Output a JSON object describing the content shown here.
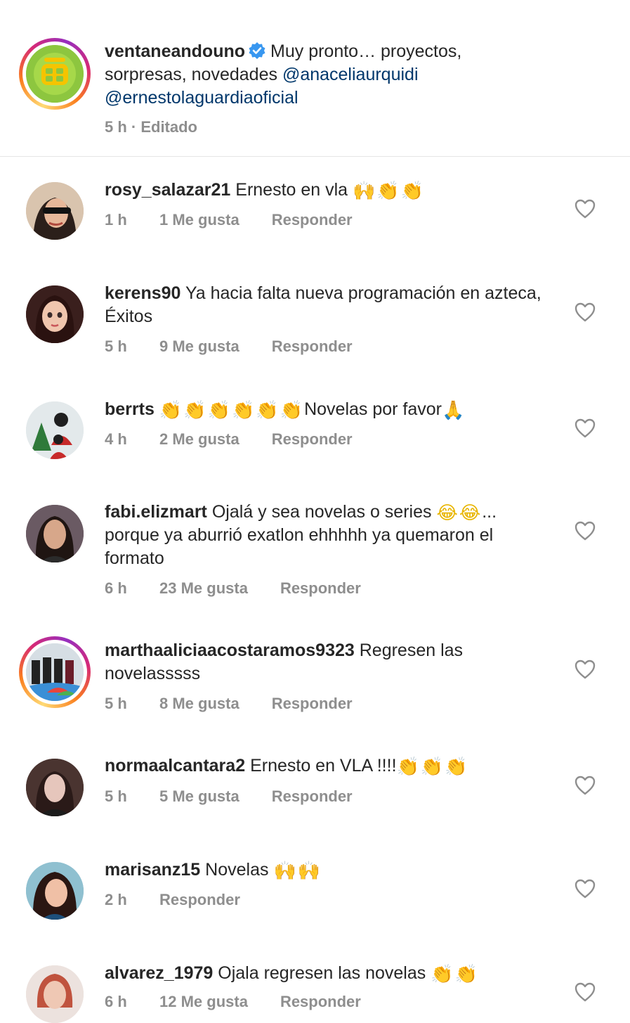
{
  "caption": {
    "username": "ventaneandouno",
    "verified": true,
    "text": "Muy pronto… proyectos, sorpresas, novedades",
    "mention1": "@anaceliaurquidi",
    "mention2": "@ernestolaguardiaoficial",
    "meta": "5 h · Editado",
    "avatar_icon": "ventaneando-logo-icon"
  },
  "comments": [
    {
      "username": "rosy_salazar21",
      "text": "Ernesto en vla",
      "emoji": "🙌👏👏",
      "time": "1 h",
      "likes": "1 Me gusta",
      "reply": "Responder"
    },
    {
      "username": "kerens90",
      "text": "Ya hacia falta nueva programación en azteca, Éxitos",
      "emoji": "",
      "time": "5 h",
      "likes": "9 Me gusta",
      "reply": "Responder"
    },
    {
      "username": "berrts",
      "text_pre": "👏👏👏👏👏👏",
      "text": "Novelas por favor",
      "emoji": "🙏",
      "time": "4 h",
      "likes": "2 Me gusta",
      "reply": "Responder"
    },
    {
      "username": "fabi.elizmart",
      "text": "Ojalá y sea  novelas o series",
      "emoji": "😂😂",
      "text_post": "... porque ya aburrió exatlon ehhhhh ya quemaron el formato",
      "time": "6 h",
      "likes": "23 Me gusta",
      "reply": "Responder"
    },
    {
      "username": "marthaaliciaacostaramos9323",
      "text": "Regresen las novelasssss",
      "emoji": "",
      "time": "5 h",
      "likes": "8 Me gusta",
      "reply": "Responder"
    },
    {
      "username": "normaalcantara2",
      "text": "Ernesto en VLA !!!!",
      "emoji": "👏👏👏",
      "time": "5 h",
      "likes": "5 Me gusta",
      "reply": "Responder"
    },
    {
      "username": "marisanz15",
      "text": "Novelas",
      "emoji": "🙌🙌",
      "time": "2 h",
      "likes": "",
      "reply": "Responder"
    },
    {
      "username": "alvarez_1979",
      "text": "Ojala regresen  las novelas",
      "emoji": "👏👏",
      "time": "6 h",
      "likes": "12 Me gusta",
      "reply": "Responder"
    }
  ],
  "colors": {
    "text": "#262626",
    "meta": "#8e8e8e",
    "mention": "#00376b",
    "verified": "#3897f0",
    "divider": "#e6e6e6"
  }
}
